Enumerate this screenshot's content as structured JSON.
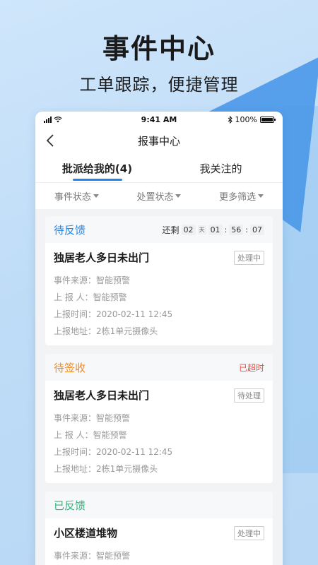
{
  "hero": {
    "title": "事件中心",
    "subtitle": "工单跟踪，便捷管理"
  },
  "status_bar": {
    "time": "9:41 AM",
    "battery": "100%"
  },
  "nav": {
    "title": "报事中心"
  },
  "tabs": [
    {
      "label": "批派给我的(4)",
      "active": true
    },
    {
      "label": "我关注的",
      "active": false
    }
  ],
  "filters": [
    {
      "label": "事件状态"
    },
    {
      "label": "处置状态"
    },
    {
      "label": "更多筛选"
    }
  ],
  "cards": [
    {
      "status": "待反馈",
      "status_color": "#1f86ea",
      "countdown": {
        "prefix": "还剩",
        "days": "02",
        "day_unit": "天",
        "hours": "01",
        "minutes": "56",
        "seconds": "07"
      },
      "title": "独居老人多日未出门",
      "tag": "处理中",
      "info": [
        {
          "key": "事件来源：",
          "value": "智能预警"
        },
        {
          "key": "上 报 人：",
          "value": "智能预警"
        },
        {
          "key": "上报时间：",
          "value": "2020-02-11 12:45"
        },
        {
          "key": "上报地址：",
          "value": "2栋1单元摄像头"
        }
      ]
    },
    {
      "status": "待签收",
      "status_color": "#f08a24",
      "overtime": "已超时",
      "title": "独居老人多日未出门",
      "tag": "待处理",
      "info": [
        {
          "key": "事件来源：",
          "value": "智能预警"
        },
        {
          "key": "上 报 人：",
          "value": "智能预警"
        },
        {
          "key": "上报时间：",
          "value": "2020-02-11 12:45"
        },
        {
          "key": "上报地址：",
          "value": "2栋1单元摄像头"
        }
      ]
    },
    {
      "status": "已反馈",
      "status_color": "#2fb37a",
      "title": "小区楼道堆物",
      "tag": "处理中",
      "info": [
        {
          "key": "事件来源：",
          "value": "智能预警"
        }
      ]
    }
  ]
}
